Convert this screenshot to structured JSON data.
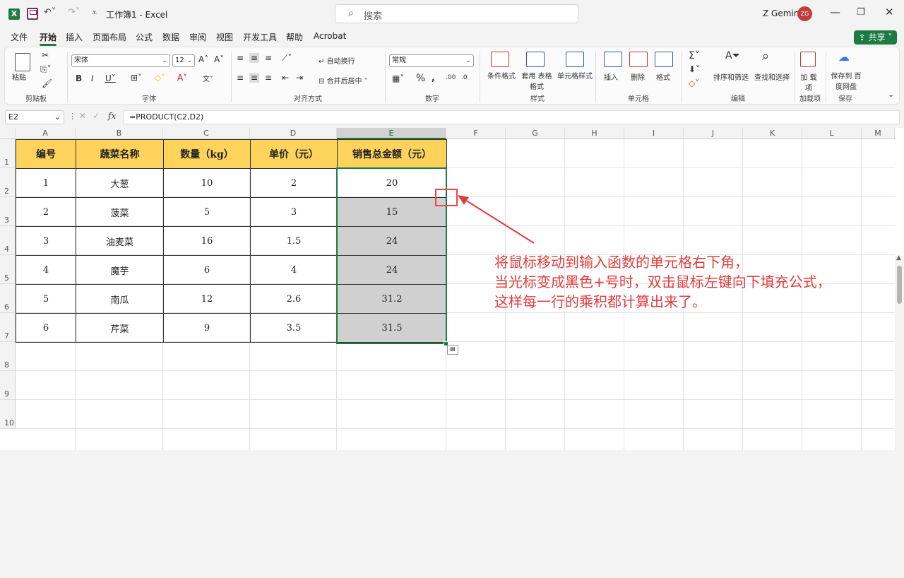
{
  "title_bar": {
    "app_icon": "X",
    "doc_title": "工作簿1 - Excel",
    "search_placeholder": "搜索",
    "user_name": "Z Gemini",
    "avatar_initials": "ZG",
    "minimize": "—",
    "restore": "❐",
    "close": "✕"
  },
  "menu": {
    "items": [
      "文件",
      "开始",
      "插入",
      "页面布局",
      "公式",
      "数据",
      "审阅",
      "视图",
      "开发工具",
      "帮助",
      "Acrobat"
    ],
    "active": "开始",
    "share": "共享"
  },
  "ribbon": {
    "clipboard": {
      "paste": "粘贴",
      "label": "剪贴板"
    },
    "font": {
      "name": "宋体",
      "size": "12",
      "label": "字体"
    },
    "alignment": {
      "wrap": "自动换行",
      "merge": "合并后居中",
      "label": "对齐方式"
    },
    "number": {
      "format": "常规",
      "label": "数字"
    },
    "styles": {
      "cond": "条件格式",
      "table": "套用 表格格式",
      "cell": "单元格样式",
      "label": "样式"
    },
    "cells": {
      "insert": "插入",
      "delete": "删除",
      "format": "格式",
      "label": "单元格"
    },
    "editing": {
      "sortfilter": "排序和筛选",
      "findselect": "查找和选择",
      "label": "编辑"
    },
    "addins": {
      "btn": "加 载项",
      "label": "加载项"
    },
    "save": {
      "btn": "保存到 百度网盘",
      "label": "保存"
    }
  },
  "formula_bar": {
    "name_box": "E2",
    "formula": "=PRODUCT(C2,D2)"
  },
  "columns": [
    "A",
    "B",
    "C",
    "D",
    "E",
    "F",
    "G",
    "H",
    "I",
    "J",
    "K",
    "L",
    "M"
  ],
  "rows": [
    "1",
    "2",
    "3",
    "4",
    "5",
    "6",
    "7",
    "8",
    "9",
    "10"
  ],
  "table": {
    "headers": [
      "编号",
      "蔬菜名称",
      "数量（kg）",
      "单价（元）",
      "销售总金额（元）"
    ],
    "rows": [
      [
        "1",
        "大葱",
        "10",
        "2",
        "20"
      ],
      [
        "2",
        "菠菜",
        "5",
        "3",
        "15"
      ],
      [
        "3",
        "油麦菜",
        "16",
        "1.5",
        "24"
      ],
      [
        "4",
        "魔芋",
        "6",
        "4",
        "24"
      ],
      [
        "5",
        "南瓜",
        "12",
        "2.6",
        "31.2"
      ],
      [
        "6",
        "芹菜",
        "9",
        "3.5",
        "31.5"
      ]
    ]
  },
  "annotation": {
    "line1": "将鼠标移动到输入函数的单元格右下角，",
    "line2": "当光标变成黑色+号时，双击鼠标左键向下填充公式，",
    "line3": "这样每一行的乘积都计算出来了。",
    "color": "#e23c3c"
  }
}
